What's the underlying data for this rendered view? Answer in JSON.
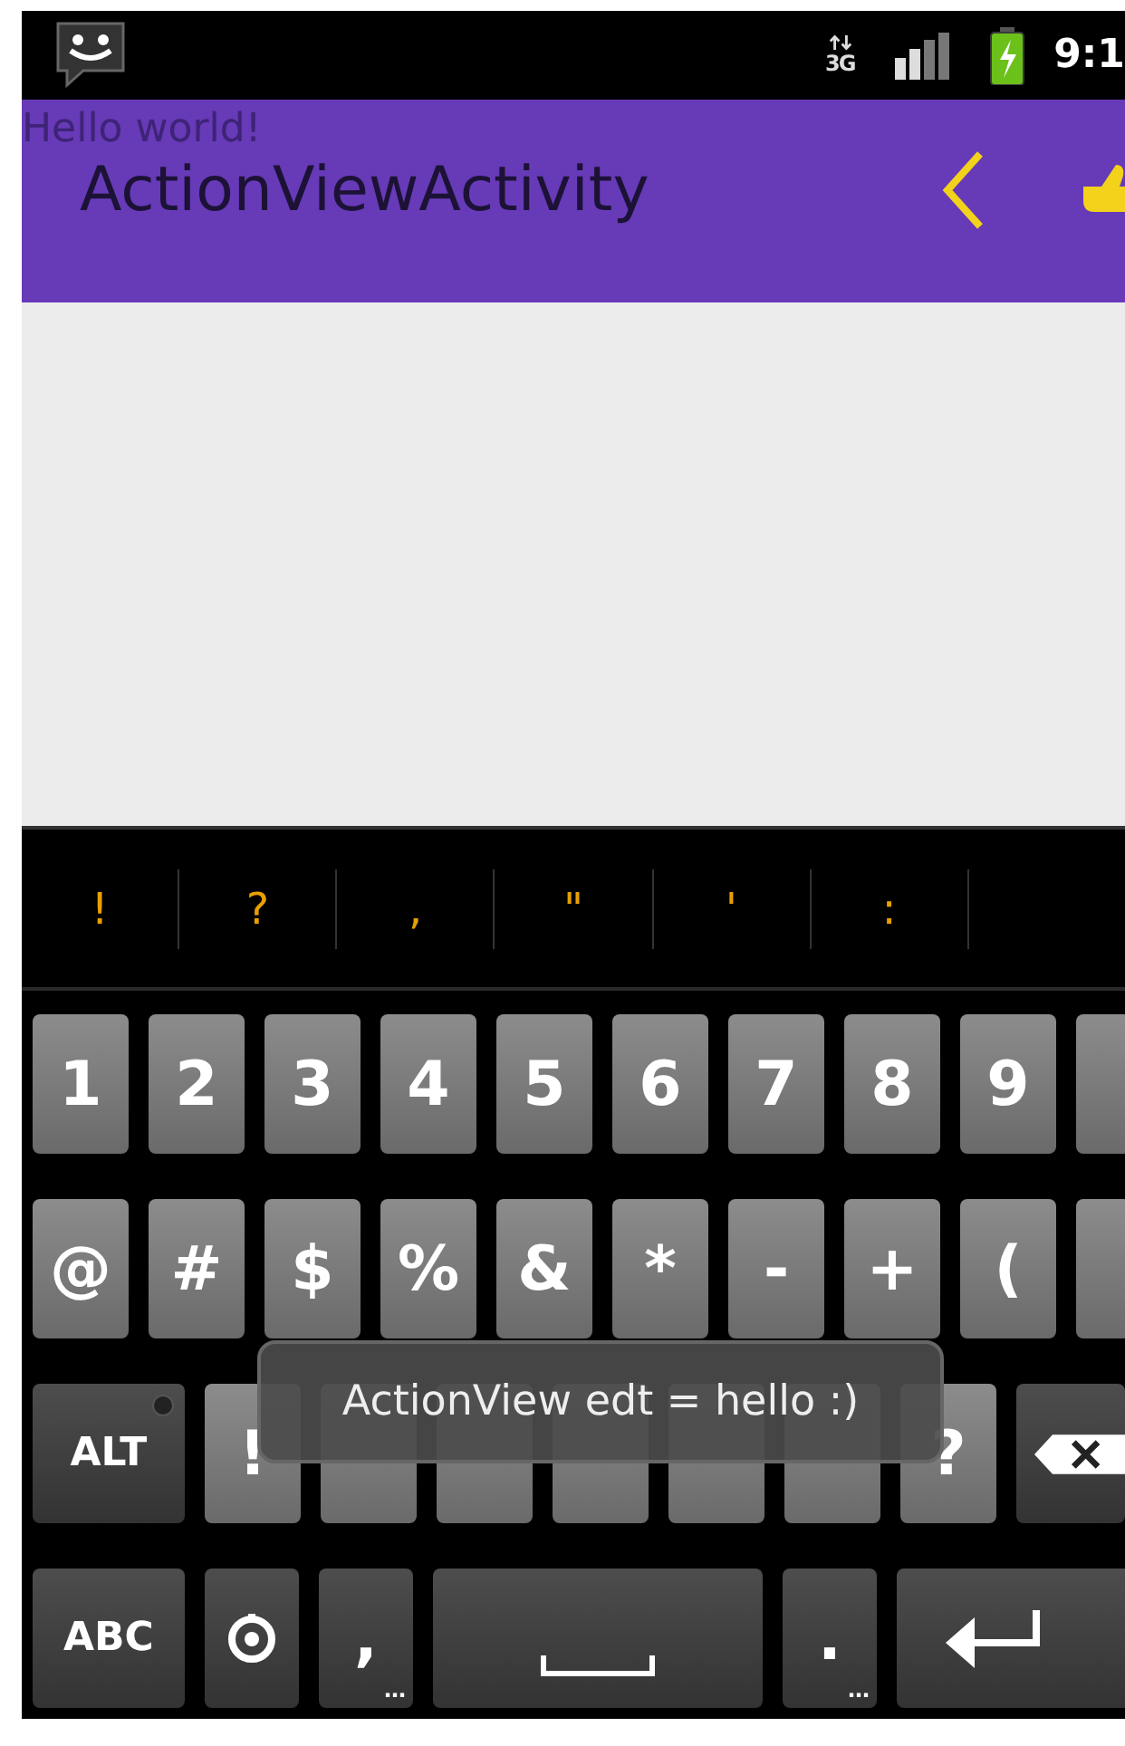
{
  "status_bar": {
    "network_type": "3G",
    "time": "9:1"
  },
  "action_bar": {
    "subtitle": "Hello world!",
    "title": "ActionViewActivity"
  },
  "keyboard": {
    "suggestions": [
      "!",
      "?",
      ",",
      "\"",
      "'",
      ":"
    ],
    "rows": [
      [
        {
          "kind": "char",
          "label": "1"
        },
        {
          "kind": "char",
          "label": "2"
        },
        {
          "kind": "char",
          "label": "3"
        },
        {
          "kind": "char",
          "label": "4"
        },
        {
          "kind": "char",
          "label": "5"
        },
        {
          "kind": "char",
          "label": "6"
        },
        {
          "kind": "char",
          "label": "7"
        },
        {
          "kind": "char",
          "label": "8"
        },
        {
          "kind": "char",
          "label": "9"
        },
        {
          "kind": "partial"
        }
      ],
      [
        {
          "kind": "char",
          "label": "@"
        },
        {
          "kind": "char",
          "label": "#"
        },
        {
          "kind": "char",
          "label": "$"
        },
        {
          "kind": "char",
          "label": "%"
        },
        {
          "kind": "char",
          "label": "&"
        },
        {
          "kind": "char",
          "label": "*"
        },
        {
          "kind": "char",
          "label": "-"
        },
        {
          "kind": "char",
          "label": "+"
        },
        {
          "kind": "char",
          "label": "("
        },
        {
          "kind": "partial"
        }
      ],
      [
        {
          "kind": "mod",
          "label": "ALT",
          "led_on": false
        },
        {
          "kind": "char",
          "label": "!"
        },
        {
          "kind": "char"
        },
        {
          "kind": "char"
        },
        {
          "kind": "char"
        },
        {
          "kind": "char"
        },
        {
          "kind": "char"
        },
        {
          "kind": "char",
          "label": "?"
        },
        {
          "kind": "delete"
        }
      ],
      [
        {
          "kind": "mod",
          "label": "ABC"
        },
        {
          "kind": "settings"
        },
        {
          "kind": "dark",
          "label": ",",
          "hint": "…"
        },
        {
          "kind": "space"
        },
        {
          "kind": "dark",
          "label": ".",
          "hint": "…"
        },
        {
          "kind": "enter"
        }
      ]
    ]
  },
  "toast": {
    "message": "ActionView edt = hello :)"
  }
}
